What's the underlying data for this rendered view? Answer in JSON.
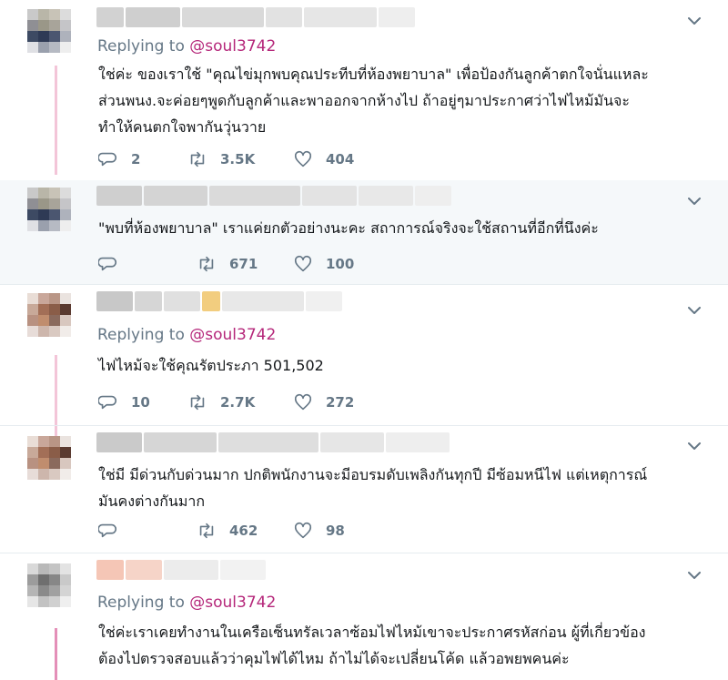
{
  "tweets": [
    {
      "replying_prefix": "Replying to",
      "replying_handle": "@soul3742",
      "text": "ใช่ค่ะ ของเราใช้ \"คุณไข่มุกพบคุณประทีบที่ห้องพยาบาล\" เพื่อป้องกันลูกค้าตกใจนั่นแหละ\nส่วนพนง.จะค่อยๆพูดกับลูกค้าและพาออกจากห้างไป ถ้าอยู่ๆมาประกาศว่าไฟไหม้มันจะ\nทำให้คนตกใจพากันวุ่นวาย",
      "replies": "2",
      "retweets": "3.5K",
      "likes": "404"
    },
    {
      "text": "\"พบที่ห้องพยาบาล\" เราแค่ยกตัวอย่างนะคะ สถาการณ์จริงจะใช้สถานที่อีกที่นึงค่ะ",
      "replies": "",
      "retweets": "671",
      "likes": "100"
    },
    {
      "replying_prefix": "Replying to",
      "replying_handle": "@soul3742",
      "text": "ไฟไหม้จะใช้คุณรัตประภา 501,502",
      "replies": "10",
      "retweets": "2.7K",
      "likes": "272"
    },
    {
      "text": "ใช่มี มีด่วนกับด่วนมาก ปกติพนักงานจะมีอบรมดับเพลิงกันทุกปี มีซ้อมหนีไฟ แต่เหตุการณ์\nมันคงต่างกันมาก",
      "replies": "",
      "retweets": "462",
      "likes": "98"
    },
    {
      "replying_prefix": "Replying to",
      "replying_handle": "@soul3742",
      "text": "ใช่ค่ะเราเคยทำงานในเครือเซ็นทรัลเวลาซ้อมไฟไหม้เขาจะประกาศรหัสก่อน ผู้ที่เกี่ยวข้อง\nต้องไปตรวจสอบแล้วว่าคุมไฟได้ไหม ถ้าไม่ได้จะเปลี่ยนโค้ด แล้วอพยพคนค่ะ"
    }
  ],
  "icons": {
    "reply": "reply-icon",
    "retweet": "retweet-icon",
    "like": "heart-icon",
    "menu": "chevron-down-icon"
  },
  "colors": {
    "handle": "#b5277a",
    "muted": "#657786",
    "thread": "#f3c5d8",
    "highlight_bg": "#f5f8fa"
  }
}
